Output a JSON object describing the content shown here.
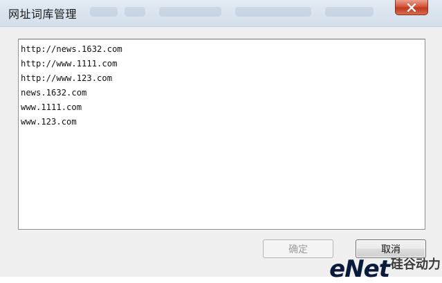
{
  "window": {
    "title": "网址词库管理"
  },
  "url_list": {
    "lines": [
      "http://news.1632.com",
      "http://www.1111.com",
      "http://www.123.com",
      "news.1632.com",
      "www.1111.com",
      "www.123.com"
    ]
  },
  "buttons": {
    "ok_label": "确定",
    "ok_enabled": false,
    "cancel_label": "取消"
  },
  "icons": {
    "close": "close-icon"
  },
  "watermark": {
    "brand_text": "eNet",
    "cn_text": "硅谷动力"
  },
  "colors": {
    "close_button": "#c7472d",
    "titlebar": "#dbe5ef",
    "dialog_background": "#f0f0f0"
  }
}
